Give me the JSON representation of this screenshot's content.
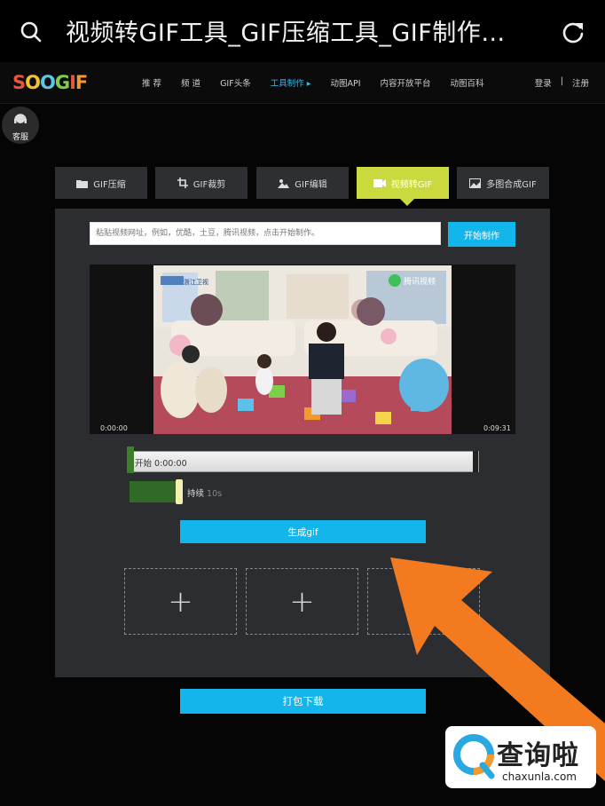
{
  "browser": {
    "title": "视频转GIF工具_GIF压缩工具_GIF制作…"
  },
  "site": {
    "logo_letters": [
      {
        "ch": "S",
        "color": "#e8543e"
      },
      {
        "ch": "O",
        "color": "#f2c230"
      },
      {
        "ch": "O",
        "color": "#5bc6e8"
      },
      {
        "ch": "G",
        "color": "#7bcf4a"
      },
      {
        "ch": "I",
        "color": "#e8543e"
      },
      {
        "ch": "F",
        "color": "#f29a2e"
      }
    ],
    "nav": [
      "推 荐",
      "频 道",
      "GIF头条",
      "工具制作 ▸",
      "动图API",
      "内容开放平台",
      "动图百科"
    ],
    "nav_active_index": 3,
    "login": "登录",
    "separator": "|",
    "register": "注册",
    "service_label": "客服"
  },
  "tabs": [
    {
      "label": "GIF压缩",
      "icon": "folder-icon"
    },
    {
      "label": "GIF裁剪",
      "icon": "crop-icon"
    },
    {
      "label": "GIF编辑",
      "icon": "image-edit-icon"
    },
    {
      "label": "视频转GIF",
      "icon": "video-icon",
      "active": true
    },
    {
      "label": "多图合成GIF",
      "icon": "images-icon"
    }
  ],
  "tool": {
    "url_placeholder": "粘贴视频网址，例如，优酷，土豆，腾讯视频，点击开始制作。",
    "start_button": "开始制作",
    "time_start": "0:00:00",
    "time_end": "0:09:31",
    "trim_label": "开始 0:00:00",
    "duration_label": "持续",
    "duration_value": "10s",
    "generate_button": "生成gif",
    "download_button": "打包下载",
    "slots": [
      "+",
      "+",
      ""
    ]
  },
  "video_overlay": {
    "channel_logo": "浙江卫视",
    "watermark": "腾讯视频"
  },
  "watermark": {
    "cn": "查询啦",
    "en": "chaxunla.com"
  },
  "colors": {
    "accent": "#14b5ea",
    "active_tab": "#c9d93e",
    "arrow": "#f47a20",
    "panel": "#2b2d31"
  }
}
